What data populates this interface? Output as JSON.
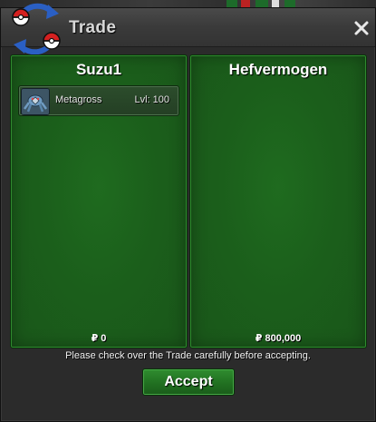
{
  "window": {
    "title": "Trade",
    "close_icon": "close-icon"
  },
  "panels": {
    "left": {
      "trainer": "Suzu1",
      "pokemon": [
        {
          "name": "Metagross",
          "level": "Lvl: 100",
          "icon": "metagross-sprite-icon"
        }
      ],
      "money": "₽ 0"
    },
    "right": {
      "trainer": "Hefvermogen",
      "pokemon": [],
      "money": "₽ 800,000"
    }
  },
  "footer": {
    "hint": "Please check over the Trade carefully before accepting.",
    "accept_label": "Accept"
  },
  "colors": {
    "panel_green": "#1b5f1b",
    "button_green": "#217021",
    "window_bg": "#2b2b2b"
  }
}
